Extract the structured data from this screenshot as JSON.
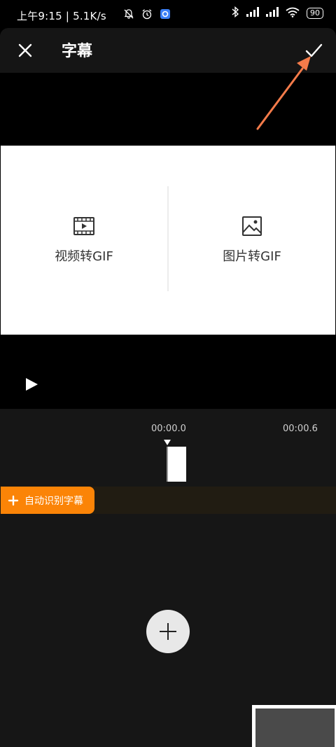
{
  "status_bar": {
    "time_speed": "上午9:15 | 5.1K/s",
    "battery": "90",
    "icons": [
      "mute-bell-icon",
      "alarm-icon",
      "app-notification-icon",
      "bluetooth-icon",
      "signal-icon",
      "signal-icon",
      "wifi-icon",
      "battery-icon"
    ]
  },
  "header": {
    "title": "字幕",
    "close_icon": "close-icon",
    "confirm_icon": "check-icon"
  },
  "preview": {
    "left_option": "视频转GIF",
    "right_option": "图片转GIF",
    "left_icon": "film-play-icon",
    "right_icon": "image-icon",
    "play_icon": "play-icon"
  },
  "timeline": {
    "start_time": "00:00.0",
    "end_time": "00:00.6",
    "auto_subtitle_button": "自动识别字幕",
    "add_icon": "plus-icon"
  },
  "colors": {
    "accent": "#fb8407",
    "arrow": "#f47b4a",
    "background": "#161616"
  }
}
